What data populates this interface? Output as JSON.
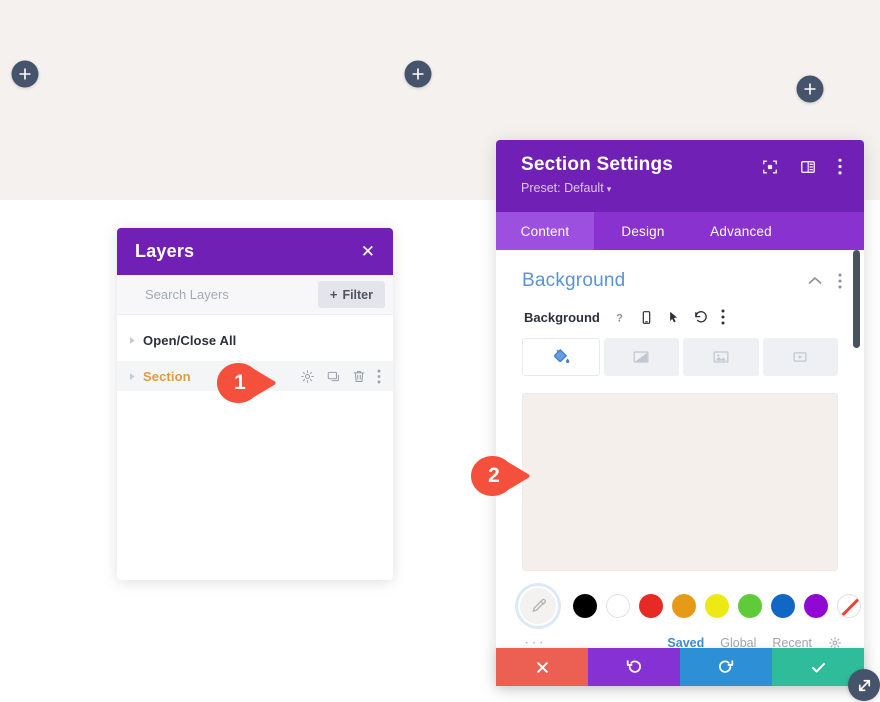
{
  "canvas": {
    "add_buttons": [
      {
        "name": "add-section-left",
        "label": "+"
      },
      {
        "name": "add-section-center",
        "label": "+"
      },
      {
        "name": "add-section-right",
        "label": "+"
      }
    ]
  },
  "layers_panel": {
    "title": "Layers",
    "close_label": "✕",
    "search": {
      "placeholder": "Search Layers",
      "value": ""
    },
    "filter_button": {
      "plus": "+",
      "label": "Filter"
    },
    "rows": [
      {
        "label": "Open/Close All",
        "type": "header"
      },
      {
        "label": "Section",
        "type": "section"
      }
    ],
    "row_action_icons": [
      "gear-icon",
      "duplicate-icon",
      "trash-icon",
      "kebab-menu-icon"
    ]
  },
  "settings_panel": {
    "title": "Section Settings",
    "preset": "Preset: Default",
    "preset_caret": "▾",
    "header_icons": [
      "expand-icon",
      "layout-icon",
      "kebab-menu-icon"
    ],
    "tabs": [
      {
        "label": "Content",
        "active": true
      },
      {
        "label": "Design",
        "active": false
      },
      {
        "label": "Advanced",
        "active": false
      }
    ],
    "background": {
      "heading": "Background",
      "heading_icons": [
        "chevron-up-icon",
        "kebab-menu-icon"
      ],
      "field_label": "Background",
      "field_icons": [
        "help-icon",
        "mobile-icon",
        "hover-icon",
        "reset-icon",
        "kebab-menu-icon"
      ],
      "type_tabs": [
        {
          "name": "background-color-tab",
          "active": true
        },
        {
          "name": "background-gradient-tab",
          "active": false
        },
        {
          "name": "background-image-tab",
          "active": false
        },
        {
          "name": "background-video-tab",
          "active": false
        }
      ],
      "preview_color": "#f5efec",
      "eyedropper": "eyedropper-icon",
      "swatches": [
        {
          "name": "swatch-black",
          "color": "#000000",
          "bordered": false,
          "transparent": false
        },
        {
          "name": "swatch-white",
          "color": "#ffffff",
          "bordered": true,
          "transparent": false
        },
        {
          "name": "swatch-red",
          "color": "#e72a23",
          "bordered": false,
          "transparent": false
        },
        {
          "name": "swatch-orange",
          "color": "#e79a16",
          "bordered": false,
          "transparent": false
        },
        {
          "name": "swatch-yellow",
          "color": "#ece914",
          "bordered": false,
          "transparent": false
        },
        {
          "name": "swatch-green",
          "color": "#5fcb3a",
          "bordered": false,
          "transparent": false
        },
        {
          "name": "swatch-blue",
          "color": "#1168c4",
          "bordered": false,
          "transparent": false
        },
        {
          "name": "swatch-purple",
          "color": "#9108d4",
          "bordered": false,
          "transparent": false
        },
        {
          "name": "swatch-transparent",
          "color": "#ffffff",
          "bordered": true,
          "transparent": true
        }
      ],
      "more_dots": "···",
      "palette_tabs": [
        {
          "label": "Saved",
          "active": true
        },
        {
          "label": "Global",
          "active": false
        },
        {
          "label": "Recent",
          "active": false
        }
      ],
      "palette_gear": "gear-icon"
    }
  },
  "action_bar": {
    "buttons": [
      {
        "name": "cancel-button",
        "icon": "close-icon",
        "color": "#ec5f53"
      },
      {
        "name": "undo-button",
        "icon": "undo-icon",
        "color": "#8531d4"
      },
      {
        "name": "redo-button",
        "icon": "redo-icon",
        "color": "#2d8fd5"
      },
      {
        "name": "save-button",
        "icon": "checkmark-icon",
        "color": "#2fbc9b"
      }
    ],
    "resize_handle": "resize-handle-icon"
  },
  "step_badges": [
    {
      "number": "1",
      "color": "#f4503c"
    },
    {
      "number": "2",
      "color": "#f4503c"
    }
  ],
  "theme": {
    "purple": "#7120b5",
    "purple_tabs": "#8a32cf",
    "purple_tab_active": "#9d50e0",
    "page_top_bg": "#f5f1ef",
    "heading_blue": "#5b93d6",
    "section_orange": "#e09b3d"
  }
}
